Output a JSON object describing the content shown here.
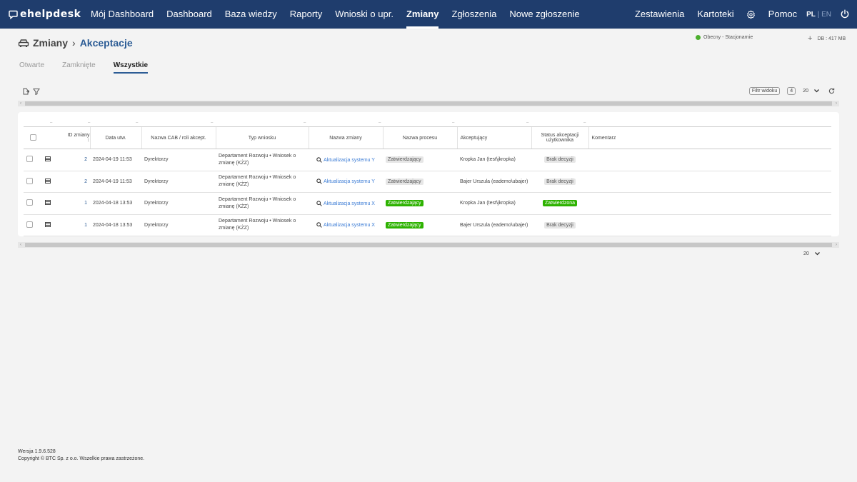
{
  "app": {
    "logo": "ehelpdesk"
  },
  "nav": {
    "items": [
      "Mój Dashboard",
      "Dashboard",
      "Baza wiedzy",
      "Raporty",
      "Wnioski o upr.",
      "Zmiany",
      "Zgłoszenia",
      "Nowe zgłoszenie"
    ],
    "active": "Zmiany",
    "right": {
      "zestawienia": "Zestawienia",
      "kartoteki": "Kartoteki",
      "pomoc": "Pomoc",
      "lang_pl": "PL",
      "lang_sep": "|",
      "lang_en": "EN"
    }
  },
  "breadcrumb": {
    "root": "Zmiany",
    "sep": "›",
    "current": "Akceptacje"
  },
  "status": {
    "label": "Obecny - Stacjonarnie",
    "color": "#4caf2e"
  },
  "db": {
    "plus": "+",
    "label": "DB : 417 MB"
  },
  "tabs": [
    "Otwarte",
    "Zamknięte",
    "Wszystkie"
  ],
  "active_tab": "Wszystkie",
  "toolbar": {
    "filter_label": "Filtr widoku",
    "count": "4",
    "page_size": "20"
  },
  "table": {
    "headers": {
      "id": "ID zmiany",
      "date": "Data utw.",
      "cab": "Nazwa CAB / roli akcept.",
      "type": "Typ wniosku",
      "name": "Nazwa zmiany",
      "process": "Nazwa procesu",
      "approver": "Akceptujący",
      "status": "Status akceptacji użytkownika",
      "comment": "Komentarz"
    },
    "filter_placeholder": "–",
    "rows": [
      {
        "id": "2",
        "date": "2024-04-19 11:53",
        "cab": "Dyrektorzy",
        "type": "Departament Rozwoju • Wniosek o zmianę (KŻZ)",
        "name": "Aktualizacja systemu Y",
        "process": "Zatwierdzający",
        "process_style": "grey",
        "approver": "Kropka Jan (test\\jkropka)",
        "status": "Brak decyzji",
        "status_style": "grey",
        "comment": ""
      },
      {
        "id": "2",
        "date": "2024-04-19 11:53",
        "cab": "Dyrektorzy",
        "type": "Departament Rozwoju • Wniosek o zmianę (KŻZ)",
        "name": "Aktualizacja systemu Y",
        "process": "Zatwierdzający",
        "process_style": "grey",
        "approver": "Bajer Urszula (eademo\\ubajer)",
        "status": "Brak decyzji",
        "status_style": "grey",
        "comment": ""
      },
      {
        "id": "1",
        "date": "2024-04-18 13:53",
        "cab": "Dyrektorzy",
        "type": "Departament Rozwoju • Wniosek o zmianę (KŻZ)",
        "name": "Aktualizacja systemu X",
        "process": "Zatwierdzający",
        "process_style": "green",
        "approver": "Kropka Jan (test\\jkropka)",
        "status": "Zatwierdzona",
        "status_style": "green",
        "comment": ""
      },
      {
        "id": "1",
        "date": "2024-04-18 13:53",
        "cab": "Dyrektorzy",
        "type": "Departament Rozwoju • Wniosek o zmianę (KŻZ)",
        "name": "Aktualizacja systemu X",
        "process": "Zatwierdzający",
        "process_style": "green",
        "approver": "Bajer Urszula (eademo\\ubajer)",
        "status": "Brak decyzji",
        "status_style": "grey",
        "comment": ""
      }
    ]
  },
  "footer": {
    "version": "Wersja 1.9.6.528",
    "copyright": "Copyright © BTC Sp. z o.o. Wszelkie prawa zastrzeżone."
  },
  "colors": {
    "nav_bg": "#1f3d6d",
    "accent": "#2c5c95",
    "link": "#3a7bd5",
    "green": "#2db200"
  }
}
